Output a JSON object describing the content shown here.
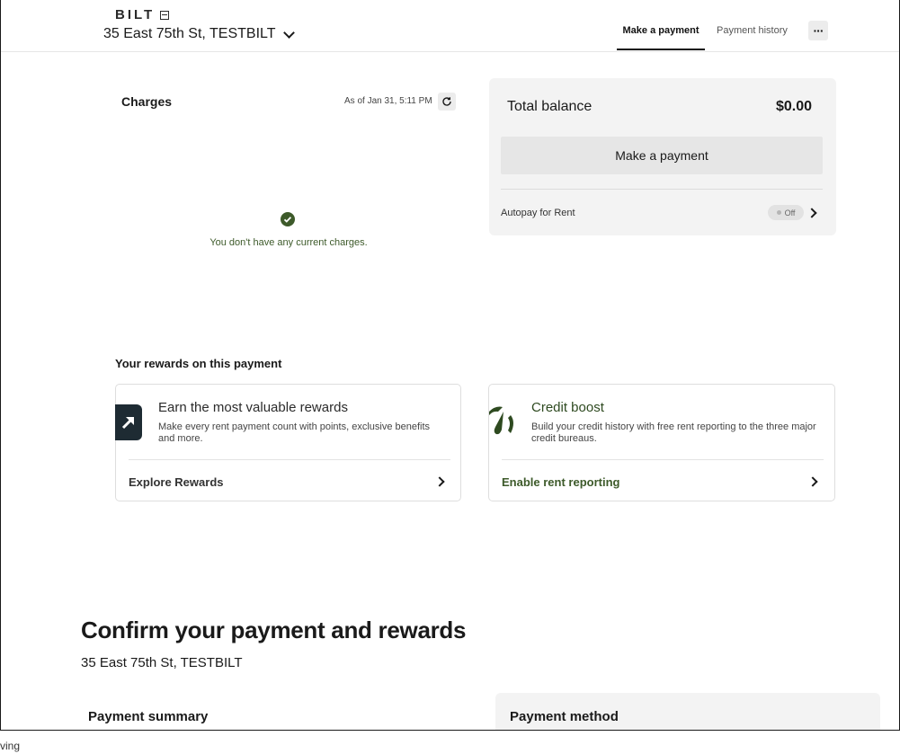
{
  "header": {
    "logo_text": "BILT",
    "property": "35 East 75th St, TESTBILT",
    "tabs": [
      {
        "label": "Make a payment",
        "active": true
      },
      {
        "label": "Payment history",
        "active": false
      }
    ],
    "more_label": "···"
  },
  "charges": {
    "title": "Charges",
    "as_of": "As of Jan 31, 5:11 PM",
    "empty_message": "You don't have any current charges."
  },
  "balance": {
    "label": "Total balance",
    "amount": "$0.00",
    "pay_button": "Make a payment",
    "autopay_label": "Autopay for Rent",
    "autopay_state": "Off"
  },
  "rewards": {
    "title": "Your rewards on this payment",
    "cards": [
      {
        "title": "Earn the most valuable rewards",
        "description": "Make every rent payment count with points, exclusive benefits and more.",
        "link": "Explore Rewards",
        "icon": "arrow-up-right-icon"
      },
      {
        "title": "Credit boost",
        "description": "Build your credit history with free rent reporting to the three major credit bureaus.",
        "link": "Enable rent reporting",
        "icon": "gauge-icon"
      }
    ]
  },
  "confirm": {
    "title": "Confirm your payment and rewards",
    "address": "35 East 75th St, TESTBILT",
    "payment_summary": "Payment summary",
    "payment_method": "Payment method"
  },
  "status_text": "ving",
  "colors": {
    "accent_green": "#3d5a2a",
    "card_bg": "#f3f3f3",
    "icon_dark": "#1e2b33"
  }
}
